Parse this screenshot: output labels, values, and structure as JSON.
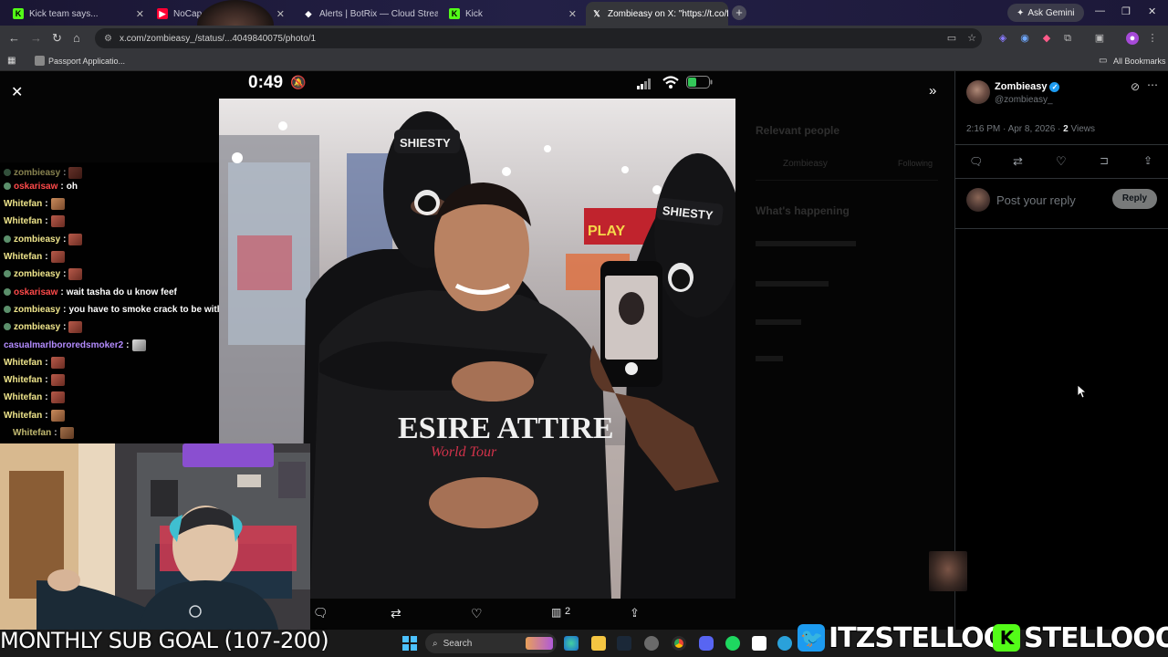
{
  "tabs": [
    {
      "label": "Kick team says...",
      "icon": "kick-icon",
      "color": "#53fc18"
    },
    {
      "label": "NoCap - ",
      "icon": "youtube-icon",
      "color": "#ff0033"
    },
    {
      "label": "Alerts | BotRix — Cloud Stream",
      "icon": "botrix-icon",
      "color": "#ffffff"
    },
    {
      "label": "Kick",
      "icon": "kick-icon",
      "color": "#53fc18"
    },
    {
      "label": "Zombieasy on X: \"https://t.co/f",
      "icon": "x-icon",
      "color": "#ffffff"
    }
  ],
  "ask_gemini": "Ask Gemini",
  "url": "x.com/zombieasy_/status/...4049840075/photo/1",
  "bookmarks": {
    "first": "Passport Applicatio...",
    "all": "All Bookmarks"
  },
  "phone": {
    "time": "0:49"
  },
  "tweet": {
    "name": "Zombieasy",
    "handle": "@zombieasy_",
    "timestamp": "2:16 PM · Apr 8, 2026 · ",
    "views_count": "2",
    "views_label": "Views",
    "reply_placeholder": "Post your reply",
    "reply_button": "Reply",
    "view_count_bar": "2"
  },
  "background_sidebar": {
    "relevant_people": "Relevant people",
    "following": "Following",
    "whats_happening": "What's happening"
  },
  "chat": [
    {
      "user": "oskarisaw",
      "color": "red",
      "msg": "oh",
      "emote": false
    },
    {
      "user": "Whitefan",
      "color": "yellow",
      "msg": "",
      "emote": true
    },
    {
      "user": "Whitefan",
      "color": "yellow",
      "msg": "",
      "emote": true
    },
    {
      "user": "zombieasy",
      "color": "yellow",
      "msg": "",
      "emote": true
    },
    {
      "user": "Whitefan",
      "color": "yellow",
      "msg": "",
      "emote": true
    },
    {
      "user": "zombieasy",
      "color": "yellow",
      "msg": "",
      "emote": true
    },
    {
      "user": "oskarisaw",
      "color": "red",
      "msg": "wait tasha do u know feef",
      "emote": false
    },
    {
      "user": "zombieasy",
      "color": "yellow",
      "msg": "you have to smoke crack to be with Stello",
      "emote": false
    },
    {
      "user": "zombieasy",
      "color": "yellow",
      "msg": "",
      "emote": true
    },
    {
      "user": "casualmarlbororedsmoker2",
      "color": "purple",
      "msg": "",
      "emote": true
    },
    {
      "user": "Whitefan",
      "color": "yellow",
      "msg": "",
      "emote": true
    },
    {
      "user": "Whitefan",
      "color": "yellow",
      "msg": "",
      "emote": true
    },
    {
      "user": "Whitefan",
      "color": "yellow",
      "msg": "",
      "emote": true
    },
    {
      "user": "Whitefan",
      "color": "yellow",
      "msg": "",
      "emote": true
    },
    {
      "user": "Whitefan",
      "color": "yellow",
      "msg": "",
      "emote": true
    }
  ],
  "overlay": {
    "sub_goal": "MONTHLY SUB GOAL (107-200)",
    "twitter_handle": "ITZSTELLOO",
    "kick_handle": "STELLOOO"
  },
  "photo": {
    "hat_text_1": "SHIESTY",
    "hat_text_2": "SHIESTY",
    "hoodie_text": "ESIRE ATTIRE",
    "hoodie_sub": "World Tour"
  },
  "taskbar": {
    "search": "Search"
  }
}
